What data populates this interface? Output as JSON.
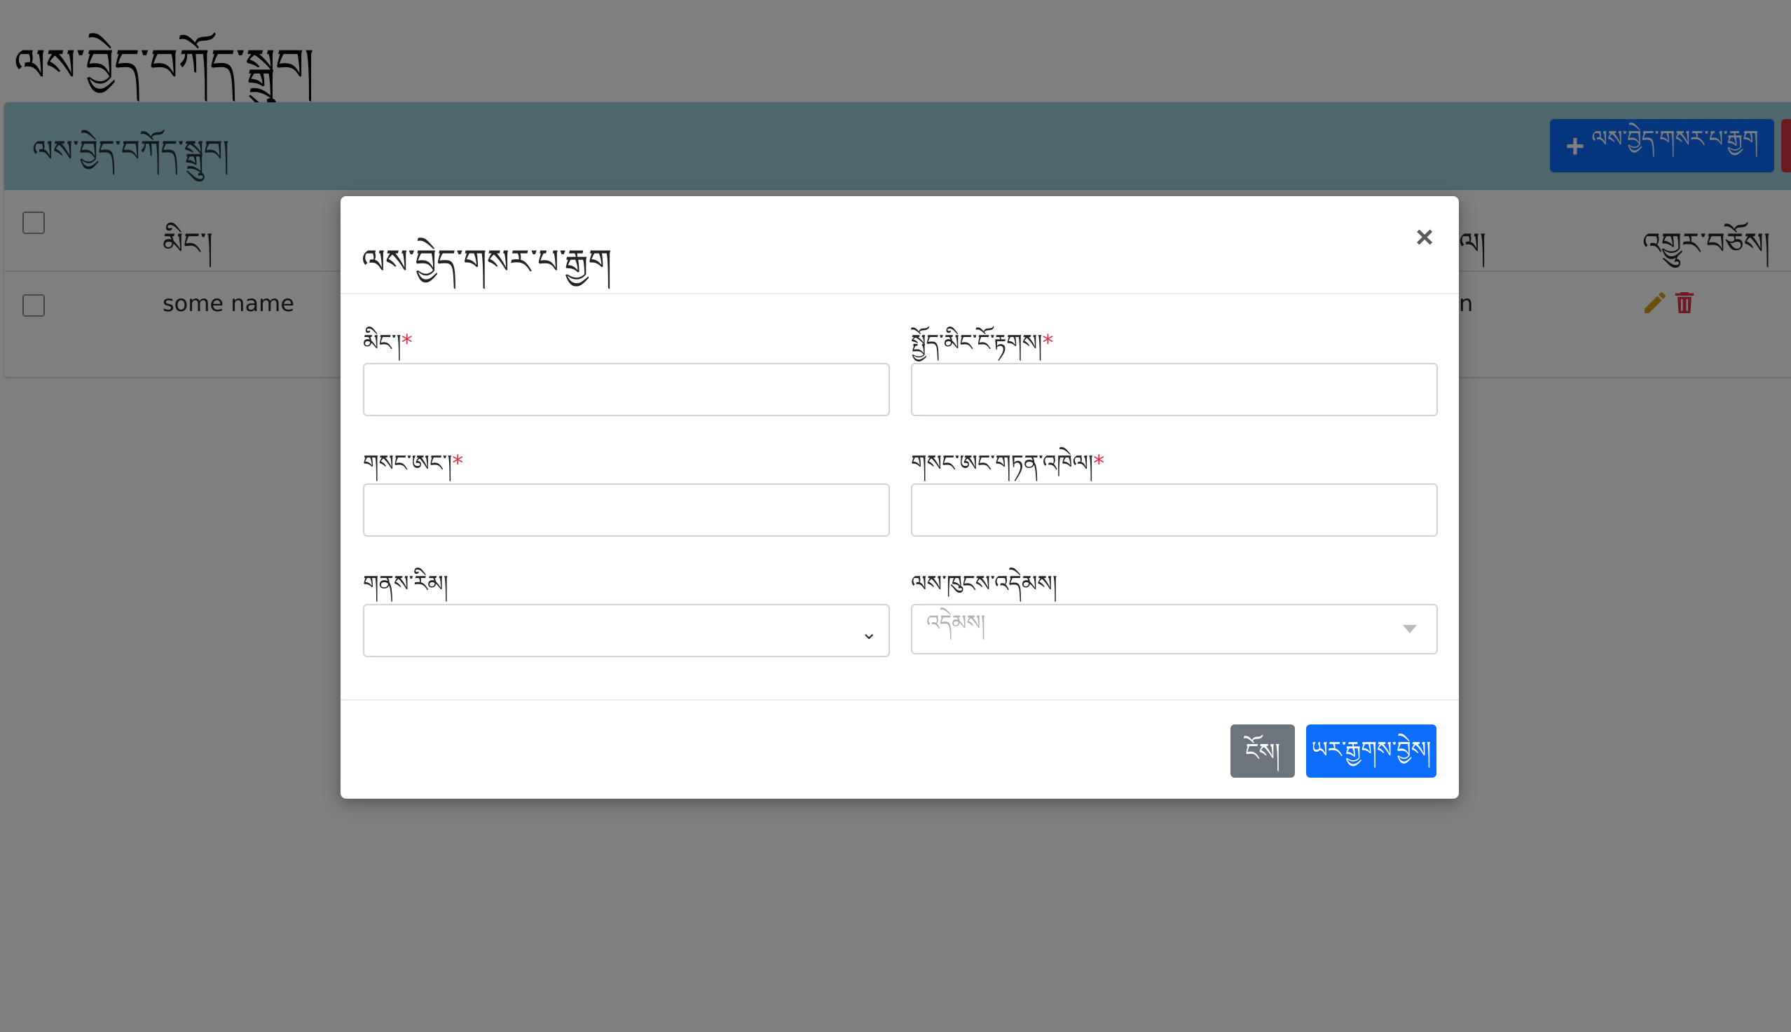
{
  "page": {
    "title": "ལས་བྱེད་བཀོད་སྒྲུབ།"
  },
  "card": {
    "title": "ལས་བྱེད་བཀོད་སྒྲུབ།",
    "add_button_label": "ལས་བྱེད་གསར་པ་རྒྱག"
  },
  "table": {
    "columns": [
      "མིང་།",
      "ལ།",
      "འགྱུར་བཅོས།"
    ],
    "rows": [
      {
        "name": "some name",
        "partial": "n"
      }
    ]
  },
  "modal": {
    "title": "ལས་བྱེད་གསར་པ་རྒྱག",
    "close_label": "×",
    "fields": {
      "name_label": "མིང་།",
      "phone_label": "སྤྱོད་མིང་ངོ་རྟགས།",
      "password_label": "གསང་ཨང་།",
      "password_confirm_label": "གསང་ཨང་གཏན་འཁེལ།",
      "gender_label": "གནས་རིམ།",
      "role_label": "ལས་ཁུངས་འདེམས།",
      "role_placeholder": "འདེམས།",
      "required_mark": "*"
    },
    "cancel_label": "ངོས།",
    "submit_label": "ཡར་རྒྱགས་བྱེས།"
  },
  "colors": {
    "primary": "#0d6efd",
    "secondary": "#6c757d",
    "danger": "#dc3545",
    "card_header": "#9fd0da",
    "edit_icon": "#d4a017"
  }
}
